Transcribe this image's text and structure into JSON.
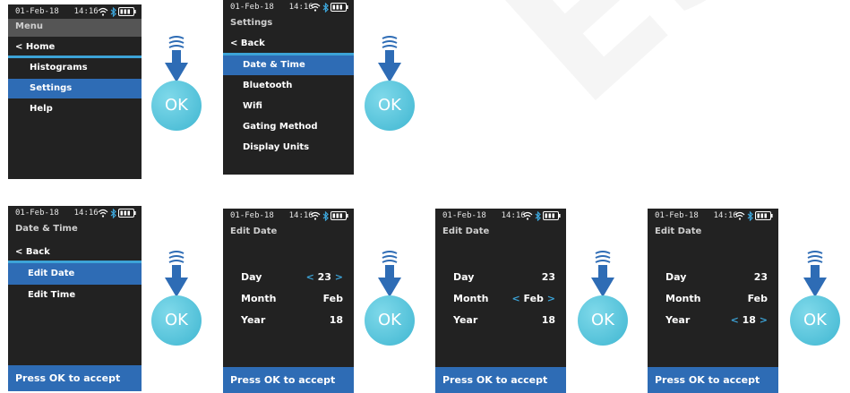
{
  "colors": {
    "screen_bg": "#222222",
    "selected_bg": "#2e6cb5",
    "separator": "#3ca3d7",
    "ok_button": "#3fb6d1",
    "arrow": "#2e6cb5"
  },
  "ok_label": "OK",
  "screens": {
    "menu": {
      "date": "01-Feb-18",
      "time": "14:16",
      "title": "Menu",
      "back": "< Home",
      "items": [
        "Histograms",
        "Settings",
        "Help"
      ]
    },
    "settings": {
      "date": "01-Feb-18",
      "time": "14:16",
      "title": "Settings",
      "back": "< Back",
      "items": [
        "Date & Time",
        "Bluetooth",
        "Wifi",
        "Gating Method",
        "Display Units"
      ]
    },
    "datetime": {
      "date": "01-Feb-18",
      "time": "14:16",
      "title": "Date & Time",
      "back": "< Back",
      "items": [
        "Edit Date",
        "Edit Time"
      ],
      "footer": "Press OK to accept"
    },
    "editdate": {
      "date": "01-Feb-18",
      "time": "14:16",
      "title": "Edit Date",
      "day_label": "Day",
      "month_label": "Month",
      "year_label": "Year",
      "day_value": "23",
      "month_value": "Feb",
      "year_value": "18",
      "arrow_left": "<",
      "arrow_right": ">",
      "footer": "Press OK to accept"
    }
  },
  "watermark": "ESCHER S"
}
